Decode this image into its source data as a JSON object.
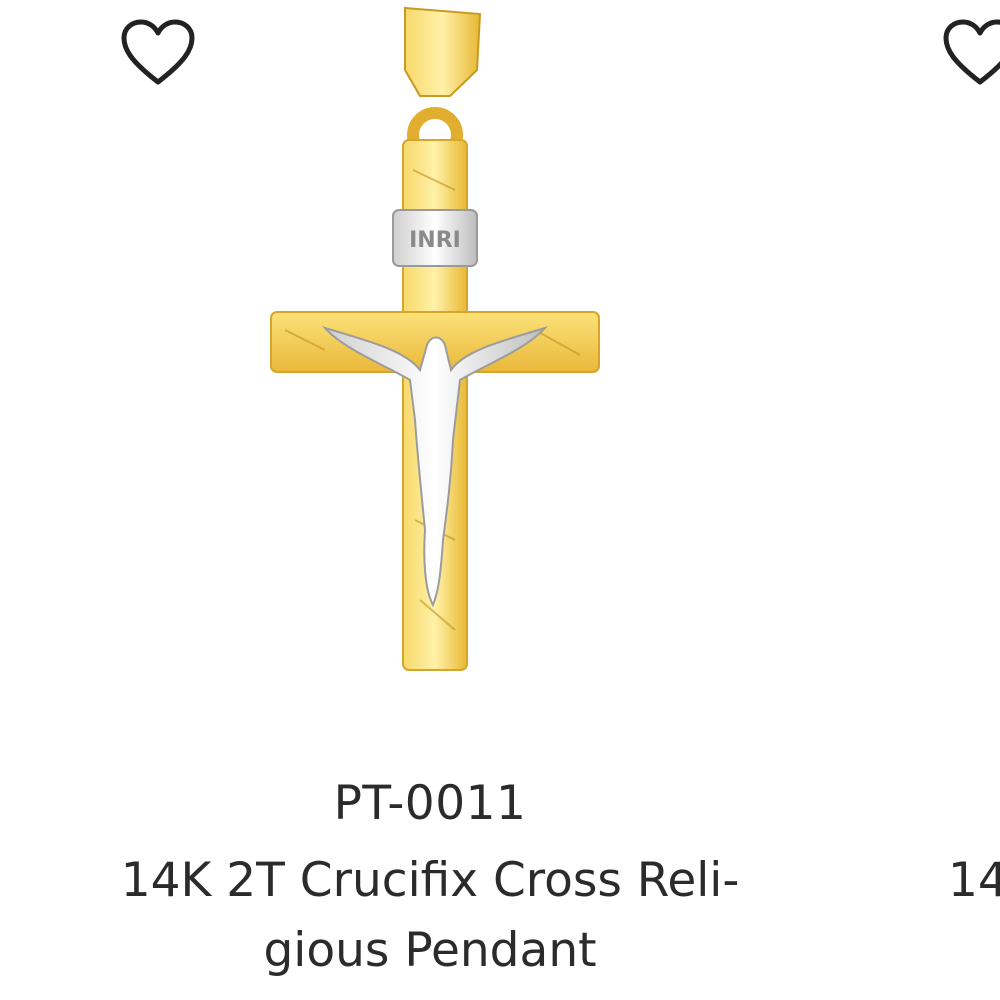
{
  "products": [
    {
      "sku": "PT-0011",
      "title_line1": "14K 2T Crucifix Cross Reli-",
      "title_line2": "gious Pendant",
      "wishlist_icon": "heart-outline-icon",
      "image": "gold-crucifix-pendant",
      "image_inscription": "INRI"
    },
    {
      "title_peek": "14",
      "wishlist_icon": "heart-outline-icon"
    }
  ],
  "colors": {
    "text": "#2b2b2b",
    "icon": "#222222",
    "gold": "#f2c94c",
    "silver": "#d9d9d9"
  }
}
